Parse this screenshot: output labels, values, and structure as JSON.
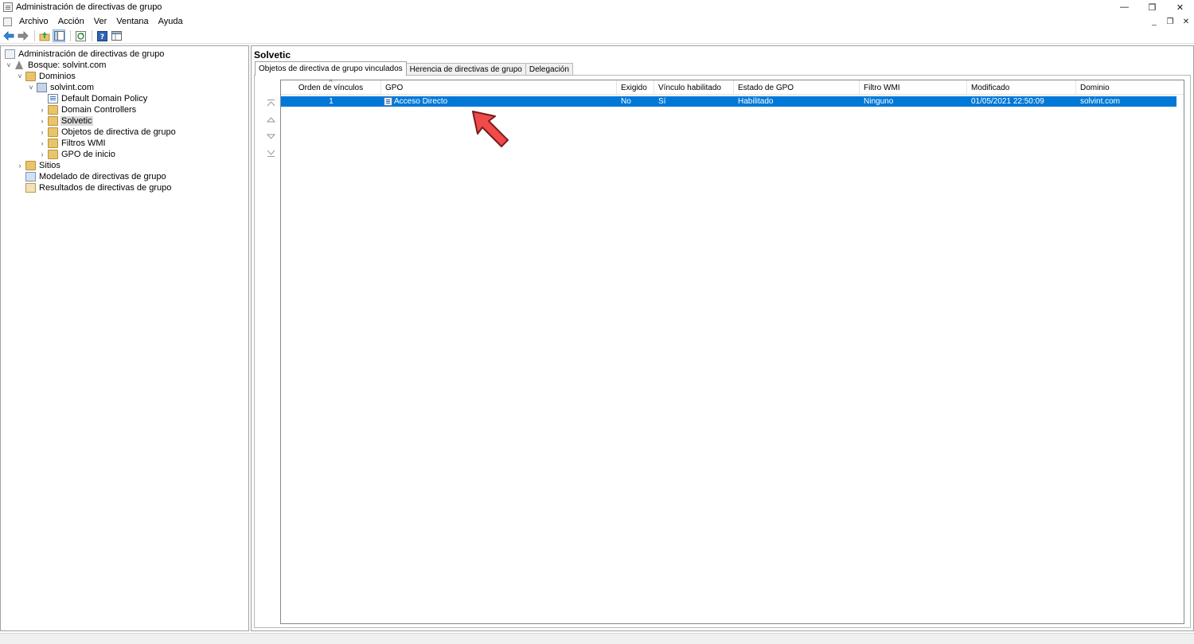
{
  "window": {
    "title": "Administración de directivas de grupo",
    "controls": {
      "minimize": "—",
      "restore": "❐",
      "close": "✕"
    },
    "mdi_controls": {
      "minimize": "_",
      "restore": "❐",
      "close": "✕"
    }
  },
  "menu": {
    "items": [
      "Archivo",
      "Acción",
      "Ver",
      "Ventana",
      "Ayuda"
    ]
  },
  "toolbar": {
    "buttons": [
      "back-arrow-icon",
      "forward-arrow-icon",
      "up-folder-icon",
      "show-hide-tree-icon",
      "refresh-icon",
      "help-icon",
      "console-view-icon"
    ]
  },
  "tree": {
    "items": [
      {
        "label": "Administración de directivas de grupo",
        "icon": "gpmc-root-icon"
      },
      {
        "label": "Bosque: solvint.com",
        "icon": "forest-icon",
        "expander": "˅"
      },
      {
        "label": "Dominios",
        "icon": "domains-folder-icon",
        "expander": "˅"
      },
      {
        "label": "solvint.com",
        "icon": "domain-icon",
        "expander": "˅"
      },
      {
        "label": "Default Domain Policy",
        "icon": "gpo-link-icon"
      },
      {
        "label": "Domain Controllers",
        "icon": "ou-folder-icon",
        "expander": "›"
      },
      {
        "label": "Solvetic",
        "icon": "ou-folder-icon",
        "expander": "›",
        "selected": true
      },
      {
        "label": "Objetos de directiva de grupo",
        "icon": "gpo-folder-icon",
        "expander": "›"
      },
      {
        "label": "Filtros WMI",
        "icon": "wmi-folder-icon",
        "expander": "›"
      },
      {
        "label": "GPO de inicio",
        "icon": "starter-gpo-folder-icon",
        "expander": "›"
      },
      {
        "label": "Sitios",
        "icon": "sites-icon",
        "expander": "›"
      },
      {
        "label": "Modelado de directivas de grupo",
        "icon": "modeling-icon"
      },
      {
        "label": "Resultados de directivas de grupo",
        "icon": "results-icon"
      }
    ]
  },
  "details": {
    "title": "Solvetic",
    "tabs": [
      "Objetos de directiva de grupo vinculados",
      "Herencia de directivas de grupo",
      "Delegación"
    ],
    "active_tab": 0,
    "order_buttons": [
      "move-top-icon",
      "move-up-icon",
      "move-down-icon",
      "move-bottom-icon"
    ],
    "columns": [
      "Orden de vínculos",
      "GPO",
      "Exigido",
      "Vínculo habilitado",
      "Estado de GPO",
      "Filtro WMI",
      "Modificado",
      "Dominio"
    ],
    "rows": [
      {
        "orden": "1",
        "gpo": "Acceso Directo",
        "exigido": "No",
        "vinculo": "Sí",
        "estado": "Habilitado",
        "filtro": "Ninguno",
        "modificado": "01/05/2021 22:50:09",
        "dominio": "solvint.com",
        "selected": true
      }
    ]
  },
  "colors": {
    "selection": "#0078d7",
    "arrow": "#f04a4a",
    "tree_selected": "#d9d9d9"
  }
}
